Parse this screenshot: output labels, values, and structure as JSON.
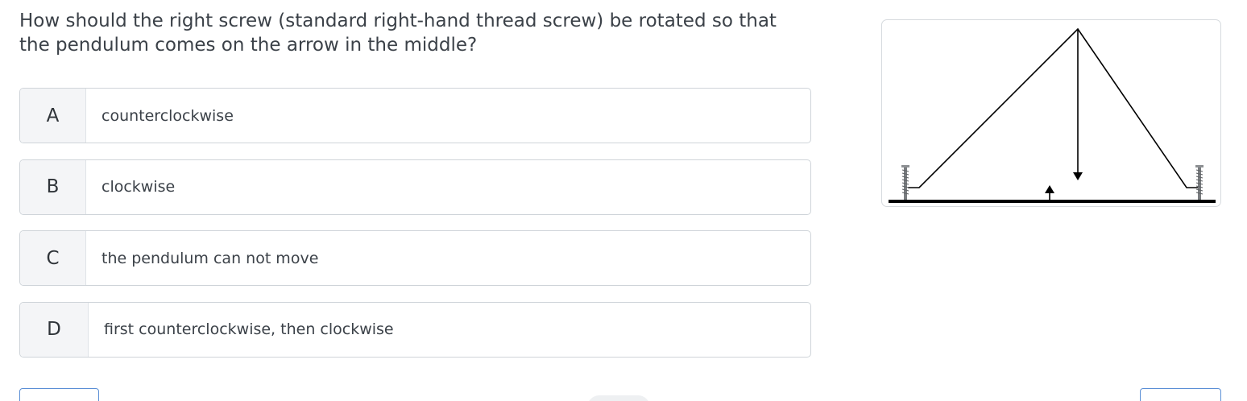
{
  "question": {
    "text": "How should the right screw (standard right-hand thread screw) be rotated so that the pendulum comes on the arrow in the middle?"
  },
  "options": [
    {
      "letter": "A",
      "text": "counterclockwise"
    },
    {
      "letter": "B",
      "text": "clockwise"
    },
    {
      "letter": "C",
      "text": "the pendulum can not move"
    },
    {
      "letter": "D",
      "text": "first counterclockwise, then clockwise"
    }
  ],
  "figure": {
    "icons": [
      "screw-icon",
      "pendulum-arrow-icon",
      "target-arrow-icon"
    ]
  },
  "colors": {
    "border": "#cfd4d9",
    "letter_bg": "#f4f5f7",
    "nav_border": "#5b8fd6"
  }
}
